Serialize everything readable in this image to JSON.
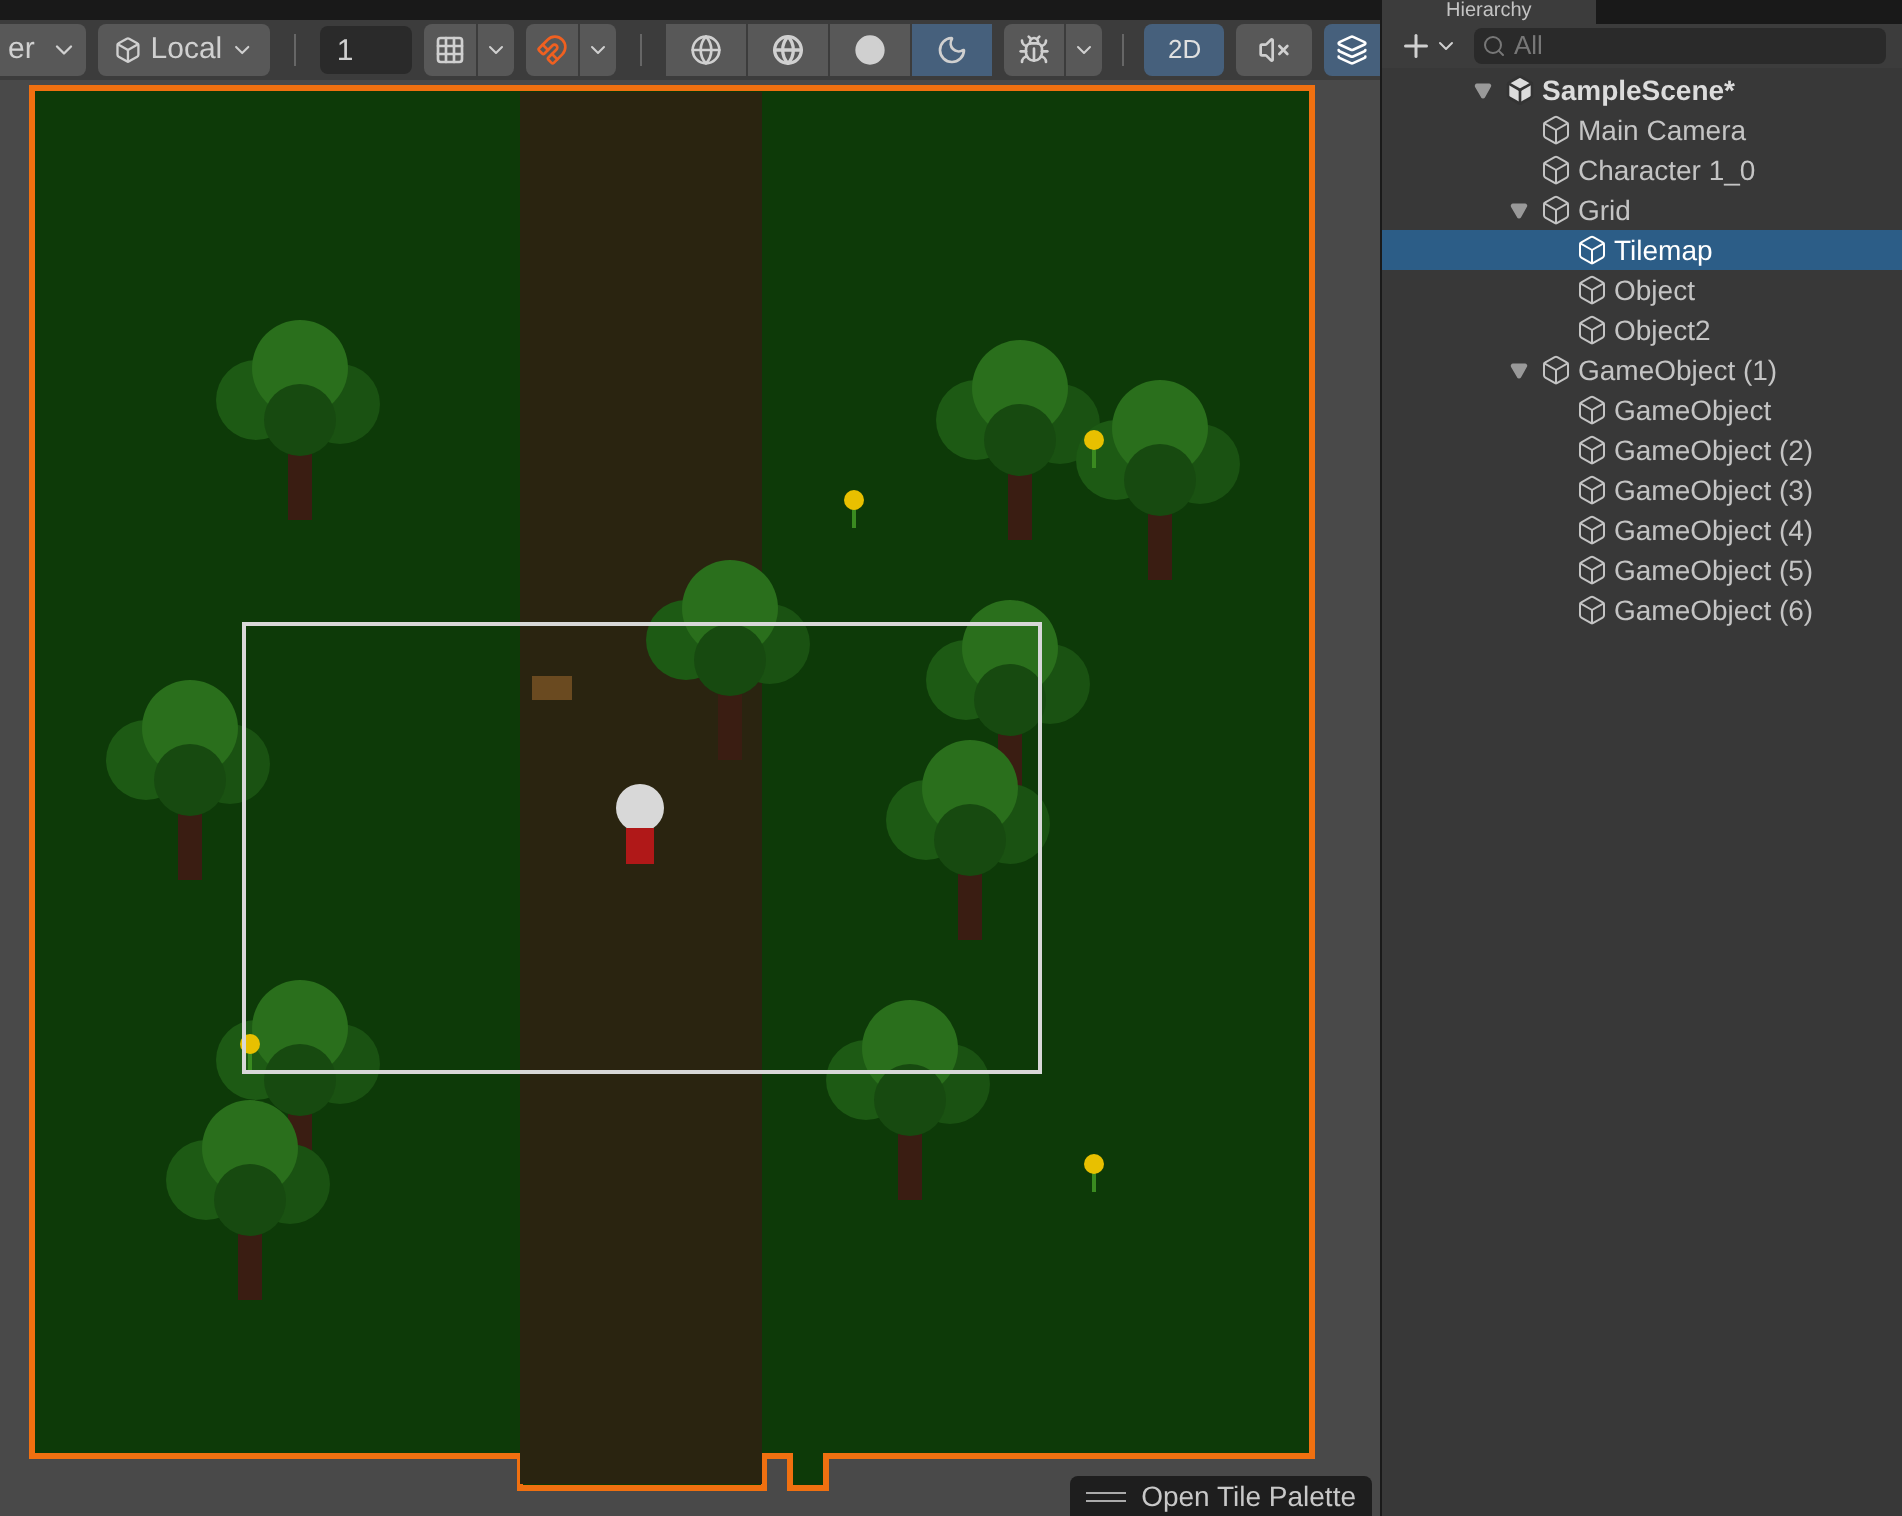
{
  "toolbar": {
    "pivot_dropdown": "er",
    "space_dropdown": "Local",
    "snap_value": "1",
    "shading_modes": [
      {
        "kind": "wireframe",
        "selected": false
      },
      {
        "kind": "shaded-wireframe",
        "selected": false
      },
      {
        "kind": "shaded",
        "selected": false
      },
      {
        "kind": "unlit",
        "selected": true
      }
    ],
    "mode_2d": {
      "label": "2D",
      "selected": true
    },
    "audio": {
      "selected": false
    }
  },
  "scene": {
    "overlay_button": "Open Tile Palette"
  },
  "hierarchy": {
    "tab": "Hierarchy",
    "search_placeholder": "All",
    "items": [
      {
        "label": "SampleScene*",
        "kind": "scene",
        "selected": false,
        "expanded": true,
        "children": [
          {
            "label": "Main Camera",
            "kind": "object",
            "selected": false
          },
          {
            "label": "Character 1_0",
            "kind": "object",
            "selected": false
          },
          {
            "label": "Grid",
            "kind": "object",
            "selected": false,
            "expanded": true,
            "children": [
              {
                "label": "Tilemap",
                "kind": "object",
                "selected": true
              },
              {
                "label": "Object",
                "kind": "object",
                "selected": false
              },
              {
                "label": "Object2",
                "kind": "object",
                "selected": false
              }
            ]
          },
          {
            "label": "GameObject (1)",
            "kind": "object",
            "selected": false,
            "expanded": true,
            "children": [
              {
                "label": "GameObject",
                "kind": "object",
                "selected": false
              },
              {
                "label": "GameObject (2)",
                "kind": "object",
                "selected": false
              },
              {
                "label": "GameObject (3)",
                "kind": "object",
                "selected": false
              },
              {
                "label": "GameObject (4)",
                "kind": "object",
                "selected": false
              },
              {
                "label": "GameObject (5)",
                "kind": "object",
                "selected": false
              },
              {
                "label": "GameObject (6)",
                "kind": "object",
                "selected": false
              }
            ]
          }
        ]
      }
    ]
  }
}
